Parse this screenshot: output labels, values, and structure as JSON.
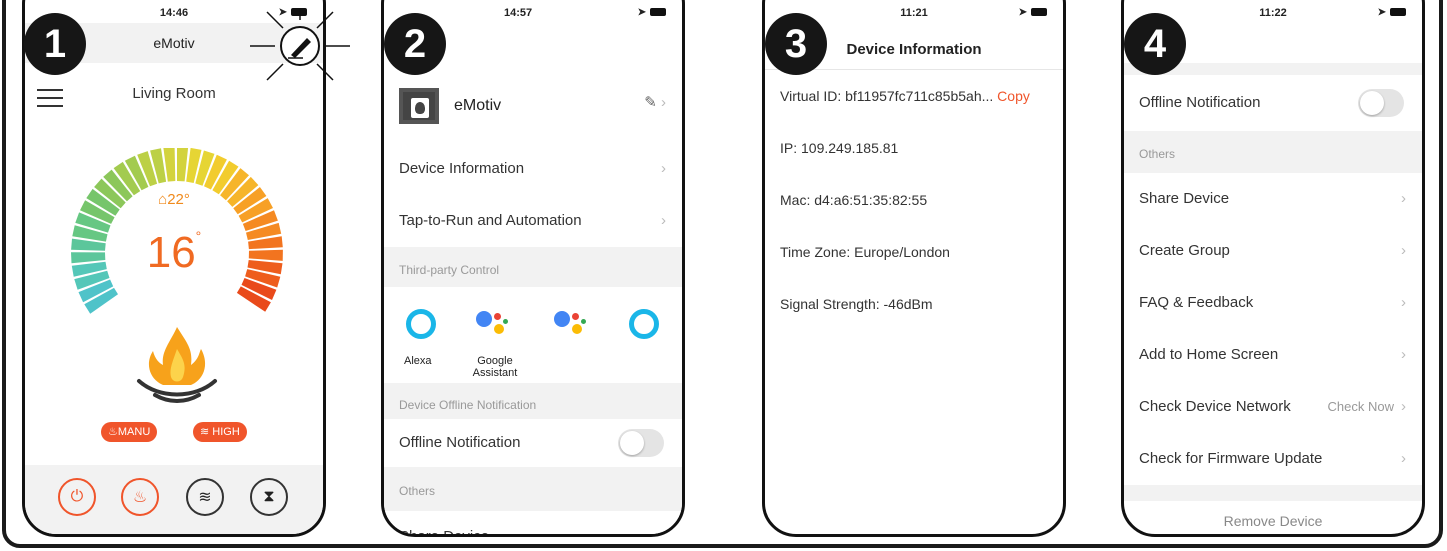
{
  "colors": {
    "accent": "#f0552b",
    "orange": "#f08a1c",
    "section_bg": "#f2f2f2"
  },
  "badges": [
    "1",
    "2",
    "3",
    "4"
  ],
  "screen1": {
    "time": "14:46",
    "app_name": "eMotiv",
    "room_name": "Living Room",
    "room_temp": "22°",
    "set_temp": "16",
    "degree": "°",
    "mode_manu": "MANU",
    "mode_high": "HIGH",
    "icons": [
      "power-icon",
      "flame-icon",
      "heat-icon",
      "timer-icon"
    ]
  },
  "screen2": {
    "time": "14:57",
    "device_name": "eMotiv",
    "menu": [
      {
        "label": "Device Information"
      },
      {
        "label": "Tap-to-Run and Automation"
      }
    ],
    "third_party_header": "Third-party Control",
    "third_party": [
      {
        "label": "Alexa",
        "icon": "alexa-icon"
      },
      {
        "label": "Google\nAssistant",
        "icon": "google-assistant-icon"
      },
      {
        "label": "",
        "icon": "google-assistant-icon"
      },
      {
        "label": "",
        "icon": "alexa-icon"
      }
    ],
    "offline_header": "Device Offline Notification",
    "offline_label": "Offline Notification",
    "others_header": "Others",
    "share_label": "Share Device"
  },
  "screen3": {
    "time": "11:21",
    "title": "Device Information",
    "virtual_id_label": "Virtual ID:",
    "virtual_id_value": "bf11957fc711c85b5ah...",
    "copy_label": "Copy",
    "ip_label": "IP:",
    "ip_value": "109.249.185.81",
    "mac_label": "Mac:",
    "mac_value": "d4:a6:51:35:82:55",
    "tz_label": "Time Zone:",
    "tz_value": "Europe/London",
    "signal_label": "Signal Strength:",
    "signal_value": "-46dBm"
  },
  "screen4": {
    "time": "11:22",
    "offline_label": "Offline Notification",
    "others_header": "Others",
    "items": [
      {
        "label": "Share Device",
        "extra": ""
      },
      {
        "label": "Create Group",
        "extra": ""
      },
      {
        "label": "FAQ & Feedback",
        "extra": ""
      },
      {
        "label": "Add to Home Screen",
        "extra": ""
      },
      {
        "label": "Check Device Network",
        "extra": "Check Now"
      },
      {
        "label": "Check for Firmware Update",
        "extra": ""
      }
    ],
    "remove_label": "Remove Device"
  }
}
